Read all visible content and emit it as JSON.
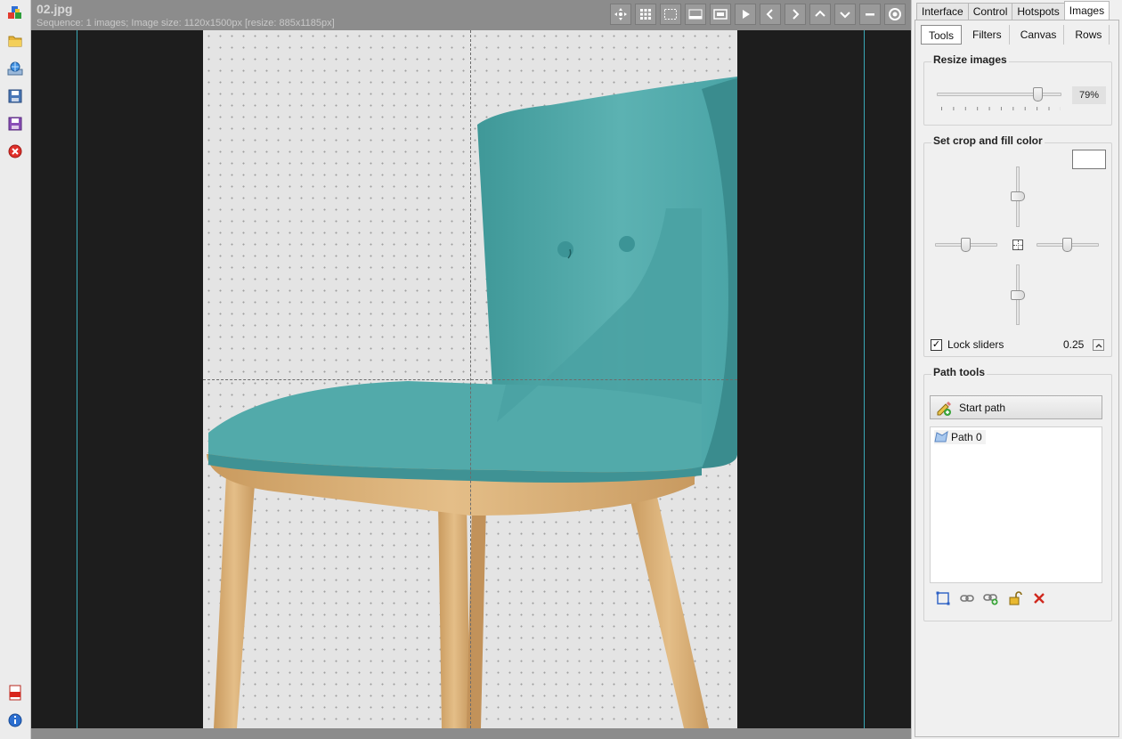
{
  "viewer": {
    "file_title": "02.jpg",
    "file_info": "Sequence: 1 images; Image size: 1120x1500px [resize: 885x1185px]"
  },
  "left_toolbar": {
    "tools": [
      "cubes-icon",
      "open-folder-icon",
      "globe-computer-icon",
      "save-disk-icon",
      "save-purple-disk-icon",
      "close-red-icon"
    ],
    "bottom_tools": [
      "pdf-icon",
      "info-icon"
    ]
  },
  "viewer_toolbar": [
    "move-arrows-icon",
    "grid-icon",
    "selection-icon",
    "filmstrip-icon",
    "fit-window-icon",
    "play-icon",
    "prev-icon",
    "next-icon",
    "up-icon",
    "down-icon",
    "minus-icon",
    "record-icon"
  ],
  "panel": {
    "top_tabs": [
      "Interface",
      "Control",
      "Hotspots",
      "Images"
    ],
    "active_top_tab": "Images",
    "sub_tabs": [
      "Tools",
      "Filters",
      "Canvas",
      "Rows"
    ],
    "active_sub_tab": "Tools",
    "resize": {
      "title": "Resize images",
      "value_label": "79%",
      "value": 79
    },
    "crop": {
      "title": "Set crop and fill color",
      "fill_color": "#ffffff",
      "lock_sliders_label": "Lock sliders",
      "lock_sliders_checked": true,
      "lock_value": "0.25"
    },
    "path_tools": {
      "title": "Path tools",
      "start_path_label": "Start path",
      "paths": [
        "Path 0"
      ],
      "tools": [
        "bounding-box-icon",
        "link-icon",
        "link-add-icon",
        "unlock-icon",
        "delete-x-icon"
      ]
    }
  },
  "colors": {
    "accent_guide": "#39a7b5",
    "canvas_bg": "#1d1d1d",
    "chair_fabric": "#4fa6a6",
    "chair_wood": "#d6ad78"
  }
}
